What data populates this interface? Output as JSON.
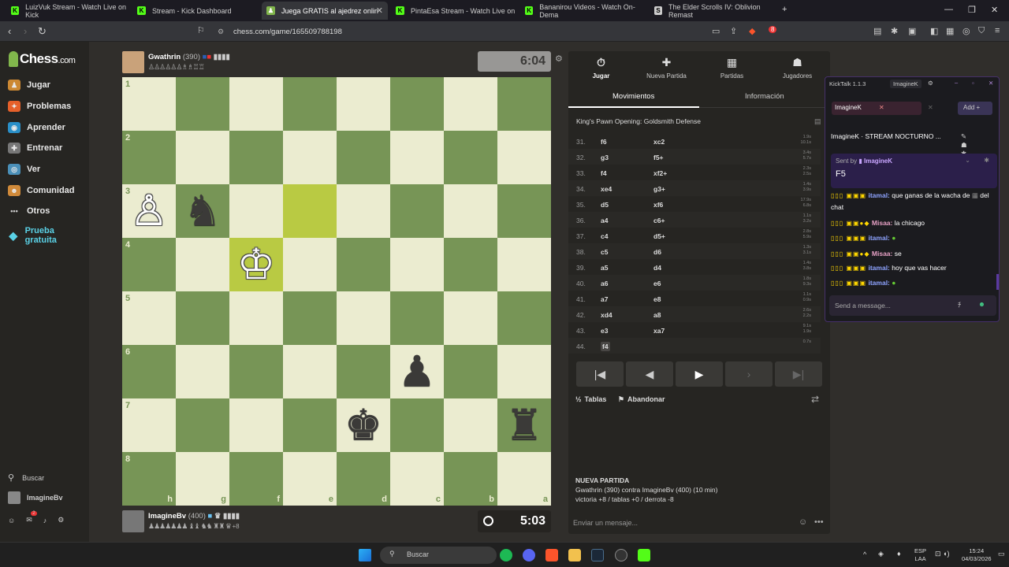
{
  "browser": {
    "tabs": [
      {
        "title": "LuizVuk Stream - Watch Live on Kick",
        "active": false
      },
      {
        "title": "Stream - Kick Dashboard",
        "active": false
      },
      {
        "title": "Juega GRATIS al ajedrez onlin",
        "active": true
      },
      {
        "title": "PintaEsa Stream - Watch Live on",
        "active": false
      },
      {
        "title": "Bananirou Videos - Watch On-Dema",
        "active": false
      },
      {
        "title": "The Elder Scrolls IV: Oblivion Remast",
        "active": false
      }
    ],
    "url": "chess.com/game/165509788198",
    "extension_badge": "8"
  },
  "sidebar": {
    "brand": "Chess",
    "brand_suffix": ".com",
    "items": [
      "Jugar",
      "Problemas",
      "Aprender",
      "Entrenar",
      "Ver",
      "Comunidad",
      "Otros"
    ],
    "premium_label": "Prueba gratuita",
    "search_label": "Buscar",
    "user": "ImagineBv",
    "mail_badge": "2"
  },
  "top_player": {
    "name": "Gwathrin",
    "rating": "(390)",
    "clock": "6:04"
  },
  "bottom_player": {
    "name": "ImagineBv",
    "rating": "(400)",
    "clock": "5:03",
    "advantage": "+8"
  },
  "board": {
    "ranks": [
      "1",
      "2",
      "3",
      "4",
      "5",
      "6",
      "7",
      "8"
    ],
    "files": [
      "h",
      "g",
      "f",
      "e",
      "d",
      "c",
      "b",
      "a"
    ]
  },
  "panel": {
    "tabs": [
      "Jugar",
      "Nueva Partida",
      "Partidas",
      "Jugadores"
    ],
    "subtabs": [
      "Movimientos",
      "Información"
    ],
    "opening": "King's Pawn Opening: Goldsmith Defense",
    "moves": [
      {
        "n": "31.",
        "w": "f6",
        "b": "xc2",
        "tw": "1.9s",
        "tb": "10.1s"
      },
      {
        "n": "32.",
        "w": "g3",
        "b": "f5+",
        "tw": "3.4s",
        "tb": "5.7s"
      },
      {
        "n": "33.",
        "w": "f4",
        "b": "xf2+",
        "tw": "2.3s",
        "tb": "2.5s"
      },
      {
        "n": "34.",
        "w": "xe4",
        "b": "g3+",
        "tw": "1.4s",
        "tb": "3.9s"
      },
      {
        "n": "35.",
        "w": "d5",
        "b": "xf6",
        "tw": "17.9s",
        "tb": "6.8s"
      },
      {
        "n": "36.",
        "w": "a4",
        "b": "c6+",
        "tw": "1.1s",
        "tb": "3.2s"
      },
      {
        "n": "37.",
        "w": "c4",
        "b": "d5+",
        "tw": "2.8s",
        "tb": "5.9s"
      },
      {
        "n": "38.",
        "w": "c5",
        "b": "d6",
        "tw": "1.3s",
        "tb": "3.1s"
      },
      {
        "n": "39.",
        "w": "a5",
        "b": "d4",
        "tw": "1.4s",
        "tb": "3.8s"
      },
      {
        "n": "40.",
        "w": "a6",
        "b": "e6",
        "tw": "1.8s",
        "tb": "9.3s"
      },
      {
        "n": "41.",
        "w": "a7",
        "b": "e8",
        "tw": "1.1s",
        "tb": "0.9s"
      },
      {
        "n": "42.",
        "w": "xd4",
        "b": "a8",
        "tw": "2.6s",
        "tb": "2.2s"
      },
      {
        "n": "43.",
        "w": "e3",
        "b": "xa7",
        "tw": "9.1s",
        "tb": "1.9s"
      },
      {
        "n": "44.",
        "w": "f4",
        "b": "",
        "tw": "0.7s",
        "tb": ""
      }
    ],
    "draw_label": "Tablas",
    "resign_label": "Abandonar",
    "newgame_title": "NUEVA PARTIDA",
    "newgame_line1": "Gwathrin (390) contra ImagineBv (400) (10 min)",
    "newgame_line2": "victoria +8 / tablas +0 / derrota -8",
    "chat_placeholder": "Enviar un mensaje..."
  },
  "kicktalk": {
    "title": "KickTalk 1.1.3",
    "profile": "ImagineK",
    "chat_tab": "ImagineK",
    "add_label": "Add",
    "stream_title": "ImagineK · STREAM NOCTURNO ...",
    "pinned_by": "Sent by",
    "pinned_user": "ImagineK",
    "pinned_msg": "F5",
    "messages": [
      {
        "user": "itamal:",
        "text": "que ganas de la wacha de",
        "text2": "del chat"
      },
      {
        "user": "Misaa:",
        "text": "la chicago"
      },
      {
        "user": "itamal:",
        "text": ""
      },
      {
        "user": "Misaa:",
        "text": "se"
      },
      {
        "user": "itamal:",
        "text": "hoy que vas hacer"
      },
      {
        "user": "itamal:",
        "text": ""
      }
    ],
    "input_placeholder": "Send a message..."
  },
  "taskbar": {
    "search": "Buscar",
    "lang": "ESP",
    "region": "LAA",
    "time": "15:24",
    "date": "04/03/2026"
  }
}
